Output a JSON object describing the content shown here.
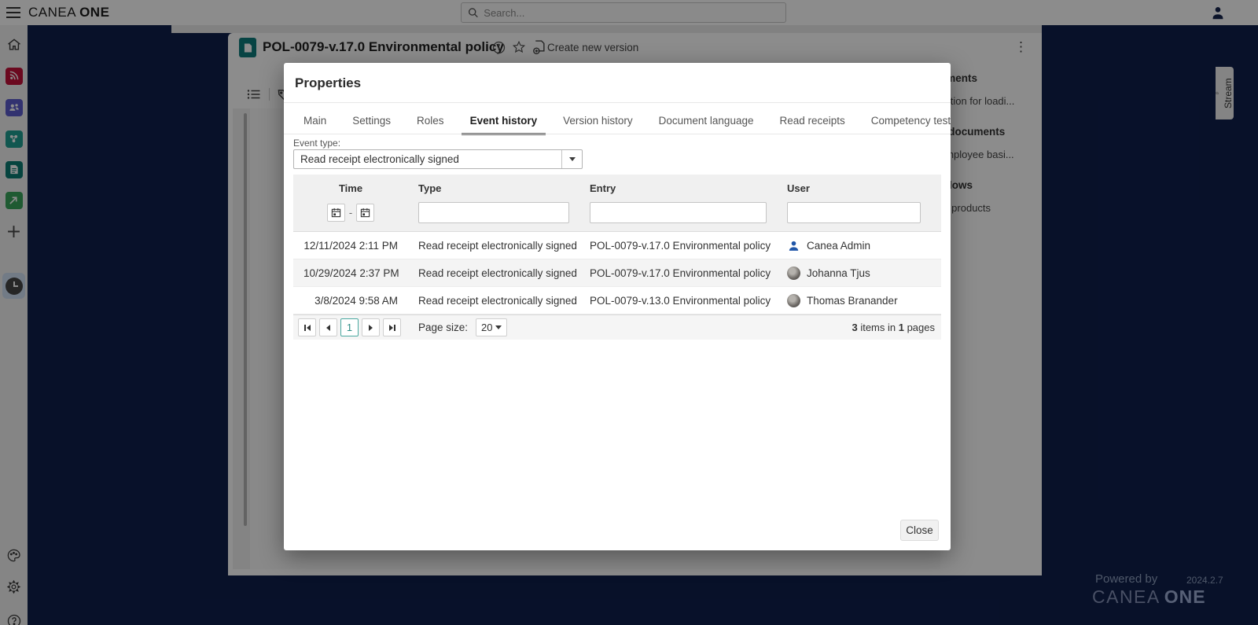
{
  "topbar": {
    "logo_part1": "CANEA",
    "logo_part2": "ONE",
    "search_placeholder": "Search..."
  },
  "sidebar": {
    "icons": [
      "menu-icon",
      "home-icon",
      "news-module-icon",
      "people-module-icon",
      "process-module-icon",
      "document-module-icon",
      "share-module-icon",
      "add-module-icon",
      "recent-clock-icon",
      "theme-palette-icon",
      "settings-gear-icon",
      "help-icon"
    ],
    "module_colors": {
      "news": "#c41239",
      "people": "#5c5ccd",
      "process": "#1f9e93",
      "documents": "#0c7d74",
      "share": "#3aa55c"
    }
  },
  "document": {
    "title": "POL-0079-v.17.0 Environmental policy",
    "create_new_version_label": "Create new version",
    "icon_color": "#0e7d7d"
  },
  "right_panel": {
    "sections": [
      {
        "heading": "uments",
        "link": "uction for loadi..."
      },
      {
        "heading": "e documents",
        "link": "employee basi..."
      },
      {
        "heading": "kflows",
        "link": "er products"
      }
    ]
  },
  "stream_tab": {
    "label": "Stream"
  },
  "footer": {
    "powered_by": "Powered by",
    "version": "2024.2.7",
    "brand_part1": "CANEA",
    "brand_part2": "ONE"
  },
  "modal": {
    "title": "Properties",
    "tabs": [
      "Main",
      "Settings",
      "Roles",
      "Event history",
      "Version history",
      "Document language",
      "Read receipts",
      "Competency test"
    ],
    "active_tab": "Event history",
    "event_type_label": "Event type:",
    "event_type_value": "Read receipt electronically signed",
    "table": {
      "columns": [
        "Time",
        "Type",
        "Entry",
        "User"
      ],
      "rows": [
        {
          "time": "12/11/2024 2:11 PM",
          "type": "Read receipt electronically signed",
          "entry": "POL-0079-v.17.0 Environmental policy",
          "user": "Canea Admin",
          "avatar": "person-icon-blue"
        },
        {
          "time": "10/29/2024 2:37 PM",
          "type": "Read receipt electronically signed",
          "entry": "POL-0079-v.17.0 Environmental policy",
          "user": "Johanna Tjus",
          "avatar": "photo"
        },
        {
          "time": "3/8/2024 9:58 AM",
          "type": "Read receipt electronically signed",
          "entry": "POL-0079-v.13.0 Environmental policy",
          "user": "Thomas Branander",
          "avatar": "photo"
        }
      ]
    },
    "pager": {
      "current_page": "1",
      "page_size_label": "Page size:",
      "page_size": "20",
      "items_count": "3",
      "items_text": " items in ",
      "pages_count": "1",
      "pages_text": " pages"
    },
    "close_label": "Close",
    "accent_teal": "#4aa8a0"
  },
  "colors": {
    "navy_background": "#0f1f4c",
    "modal_header_gray": "#f0f0f0",
    "scrim": "rgba(0,0,0,0.45)"
  }
}
